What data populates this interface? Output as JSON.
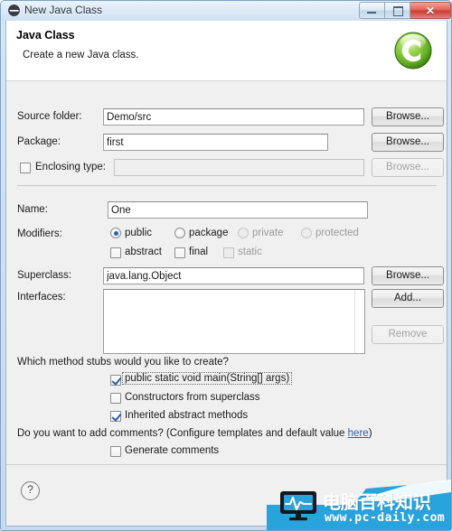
{
  "window": {
    "title": "New Java Class",
    "icon": "eclipse-icon",
    "buttons": {
      "minimize": "minimize-button",
      "maximize": "maximize-button",
      "close_glyph": "✕"
    }
  },
  "header": {
    "title": "Java Class",
    "subtitle": "Create a new Java class.",
    "icon": "java-class-icon",
    "icon_letter": "C",
    "icon_color": "#6bb92f"
  },
  "form": {
    "source_folder": {
      "label": "Source folder:",
      "value": "Demo/src",
      "button": "Browse...",
      "enabled": true
    },
    "package": {
      "label": "Package:",
      "value": "first",
      "button": "Browse...",
      "enabled": true
    },
    "enclosing_type": {
      "label": "Enclosing type:",
      "value": "",
      "button": "Browse...",
      "checked": false,
      "enabled": false
    },
    "name": {
      "label": "Name:",
      "value": "One"
    },
    "modifiers": {
      "label": "Modifiers:",
      "access": [
        {
          "label": "public",
          "selected": true,
          "enabled": true
        },
        {
          "label": "package",
          "selected": false,
          "enabled": true
        },
        {
          "label": "private",
          "selected": false,
          "enabled": false
        },
        {
          "label": "protected",
          "selected": false,
          "enabled": false
        }
      ],
      "flags": [
        {
          "label": "abstract",
          "checked": false,
          "enabled": true
        },
        {
          "label": "final",
          "checked": false,
          "enabled": true
        },
        {
          "label": "static",
          "checked": false,
          "enabled": false
        }
      ]
    },
    "superclass": {
      "label": "Superclass:",
      "value": "java.lang.Object",
      "button": "Browse..."
    },
    "interfaces": {
      "label": "Interfaces:",
      "items": [],
      "add_button": "Add...",
      "remove_button": "Remove",
      "remove_enabled": false
    }
  },
  "stubs": {
    "question": "Which method stubs would you like to create?",
    "options": [
      {
        "label": "public static void main(String[] args)",
        "checked": true,
        "focused": true
      },
      {
        "label": "Constructors from superclass",
        "checked": false,
        "focused": false
      },
      {
        "label": "Inherited abstract methods",
        "checked": true,
        "focused": false
      }
    ]
  },
  "comments": {
    "question_prefix": "Do you want to add comments? (Configure templates and default value ",
    "link": "here",
    "question_suffix": ")",
    "option": {
      "label": "Generate comments",
      "checked": false
    }
  },
  "footer": {
    "help_icon": "?",
    "help_glyph": "?"
  },
  "watermark": {
    "text_cn": "电脑百科知识",
    "url": "www.pc-daily.com",
    "icon": "monitor-pulse-icon",
    "color": "#29a3dc"
  }
}
